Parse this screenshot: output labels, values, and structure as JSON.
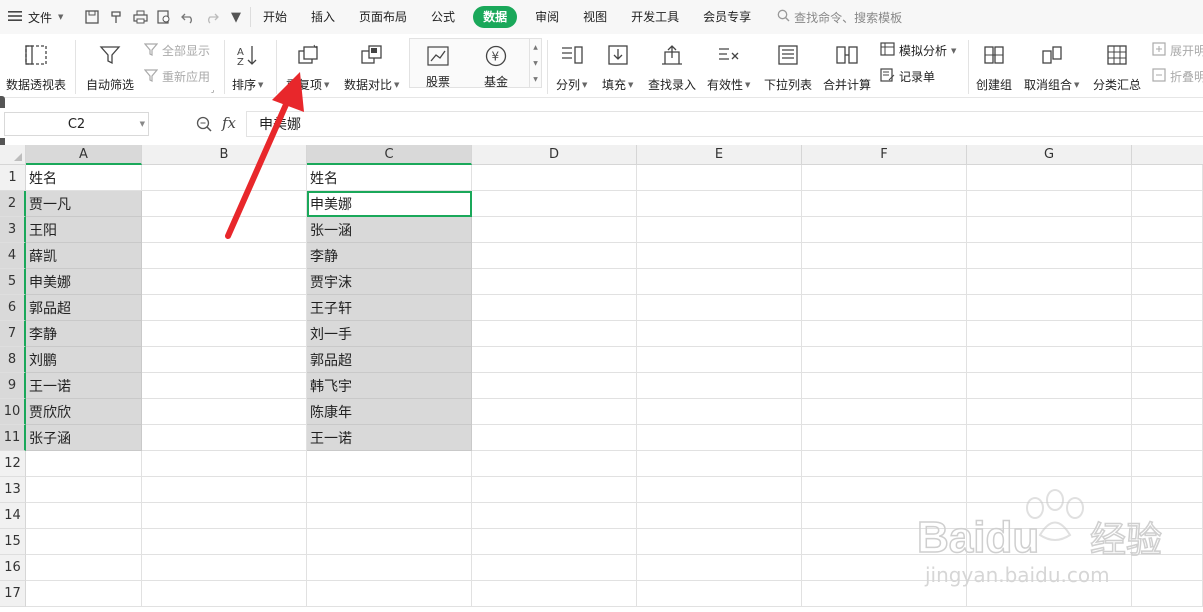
{
  "menubar": {
    "file_label": "文件",
    "tabs": [
      "开始",
      "插入",
      "页面布局",
      "公式",
      "数据",
      "审阅",
      "视图",
      "开发工具",
      "会员专享"
    ],
    "active_tab": "数据",
    "search_placeholder": "查找命令、搜索模板"
  },
  "ribbon": {
    "pivot": "数据透视表",
    "autofilter": "自动筛选",
    "show_all": "全部显示",
    "reapply": "重新应用",
    "sort": "排序",
    "duplicates": "重复项",
    "compare": "数据对比",
    "stock": "股票",
    "fund": "基金",
    "split": "分列",
    "fill": "填充",
    "lookup": "查找录入",
    "validity": "有效性",
    "dropdown": "下拉列表",
    "consolidate": "合并计算",
    "whatif": "模拟分析",
    "record": "记录单",
    "group": "创建组",
    "ungroup": "取消组合",
    "subtotal": "分类汇总",
    "expand": "展开明",
    "collapse": "折叠明"
  },
  "formula_bar": {
    "name_box": "C2",
    "fx_label": "fx",
    "content": "申美娜"
  },
  "sheet": {
    "columns": [
      "A",
      "B",
      "C",
      "D",
      "E",
      "F",
      "G"
    ],
    "rows": [
      "1",
      "2",
      "3",
      "4",
      "5",
      "6",
      "7",
      "8",
      "9",
      "10",
      "11",
      "12",
      "13",
      "14",
      "15",
      "16",
      "17"
    ],
    "col_a": [
      "姓名",
      "贾一凡",
      "王阳",
      "薛凯",
      "申美娜",
      "郭品超",
      "李静",
      "刘鹏",
      "王一诺",
      "贾欣欣",
      "张子涵"
    ],
    "col_c": [
      "姓名",
      "申美娜",
      "张一涵",
      "李静",
      "贾宇沫",
      "王子轩",
      "刘一手",
      "郭品超",
      "韩飞宇",
      "陈康年",
      "王一诺"
    ]
  },
  "colors": {
    "accent": "#1aa85a",
    "selection_fill": "#d9d9d9",
    "annotation_arrow": "#e8272b"
  },
  "watermark": {
    "brand": "Baidu",
    "brand_cn": "经验",
    "url": "jingyan.baidu.com"
  }
}
